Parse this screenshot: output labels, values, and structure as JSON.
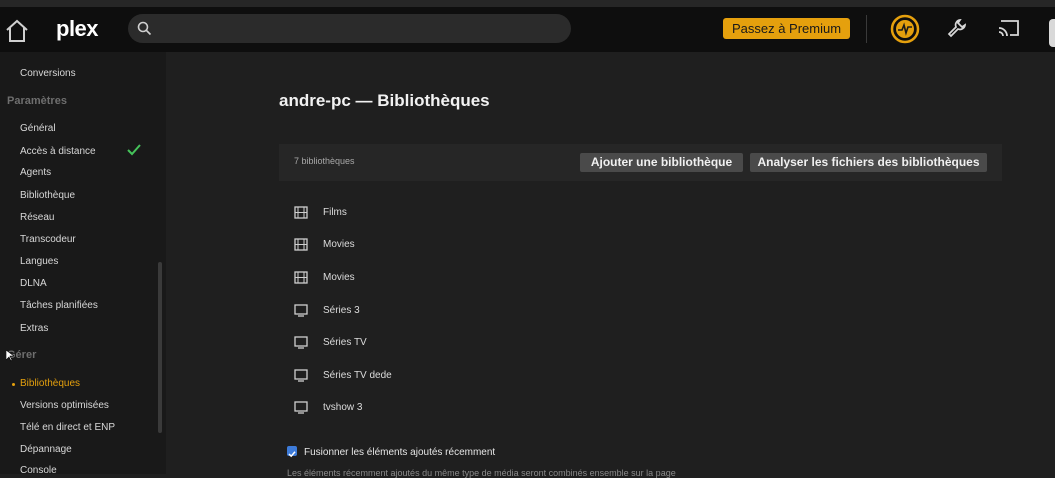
{
  "header": {
    "logo_main": "plex",
    "search_placeholder": "",
    "premium_label": "Passez à Premium"
  },
  "sidebar": {
    "top_item": "Conversions",
    "section_settings": "Paramètres",
    "settings_items": [
      "Général",
      "Accès à distance",
      "Agents",
      "Bibliothèque",
      "Réseau",
      "Transcodeur",
      "Langues",
      "DLNA",
      "Tâches planifiées",
      "Extras"
    ],
    "section_manage": "Gérer",
    "manage_items": [
      "Bibliothèques",
      "Versions optimisées",
      "Télé en direct et ENP",
      "Dépannage",
      "Console"
    ],
    "active_item": "Bibliothèques"
  },
  "main": {
    "title": "andre-pc — Bibliothèques",
    "library_count": "7 bibliothèques",
    "add_button": "Ajouter une bibliothèque",
    "scan_button": "Analyser les fichiers des bibliothèques",
    "libraries": [
      {
        "name": "Films",
        "icon": "film-icon"
      },
      {
        "name": "Movies",
        "icon": "film-icon"
      },
      {
        "name": "Movies",
        "icon": "film-icon"
      },
      {
        "name": "Séries 3",
        "icon": "tv-icon"
      },
      {
        "name": "Séries TV",
        "icon": "tv-icon"
      },
      {
        "name": "Séries TV dede",
        "icon": "tv-icon"
      },
      {
        "name": "tvshow 3",
        "icon": "tv-icon"
      }
    ],
    "merge_label": "Fusionner les éléments ajoutés récemment",
    "merge_checked": true,
    "help_text": "Les éléments récemment ajoutés du même type de média seront combinés ensemble sur la page"
  },
  "colors": {
    "accent": "#e5a00d",
    "checkbox": "#3d7bd9",
    "check_green": "#45c35a"
  }
}
